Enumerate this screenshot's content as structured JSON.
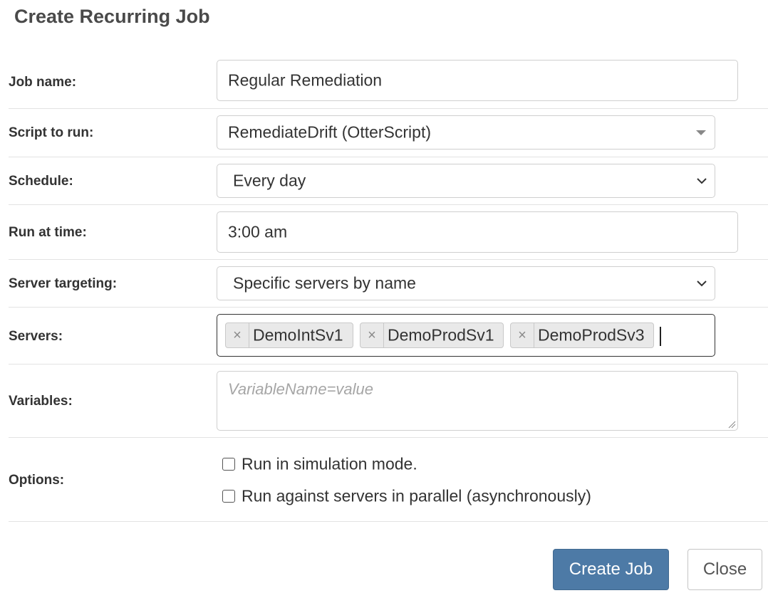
{
  "dialog": {
    "title": "Create Recurring Job"
  },
  "form": {
    "job_name": {
      "label": "Job name:",
      "value": "Regular Remediation"
    },
    "script": {
      "label": "Script to run:",
      "value": "RemediateDrift (OtterScript)"
    },
    "schedule": {
      "label": "Schedule:",
      "value": "Every day"
    },
    "run_at": {
      "label": "Run at time:",
      "value": "3:00 am"
    },
    "targeting": {
      "label": "Server targeting:",
      "value": "Specific servers by name"
    },
    "servers": {
      "label": "Servers:",
      "tags": [
        "DemoIntSv1",
        "DemoProdSv1",
        "DemoProdSv3"
      ],
      "remove_glyph": "×"
    },
    "variables": {
      "label": "Variables:",
      "placeholder": "VariableName=value"
    },
    "options": {
      "label": "Options:",
      "items": [
        {
          "label": "Run in simulation mode.",
          "checked": false
        },
        {
          "label": "Run against servers in parallel (asynchronously)",
          "checked": false
        }
      ]
    }
  },
  "buttons": {
    "create_label": "Create Job",
    "close_label": "Close"
  },
  "icons": {
    "script_caret": "caret-down-icon",
    "schedule_caret": "chevron-down-icon",
    "targeting_caret": "chevron-down-icon",
    "tag_remove": "close-icon",
    "resize_grip": "resize-grip-icon"
  },
  "colors": {
    "primary": "#4d7aa6",
    "text": "#333333",
    "placeholder": "#a6a6a6",
    "border": "#cfcfcf"
  }
}
